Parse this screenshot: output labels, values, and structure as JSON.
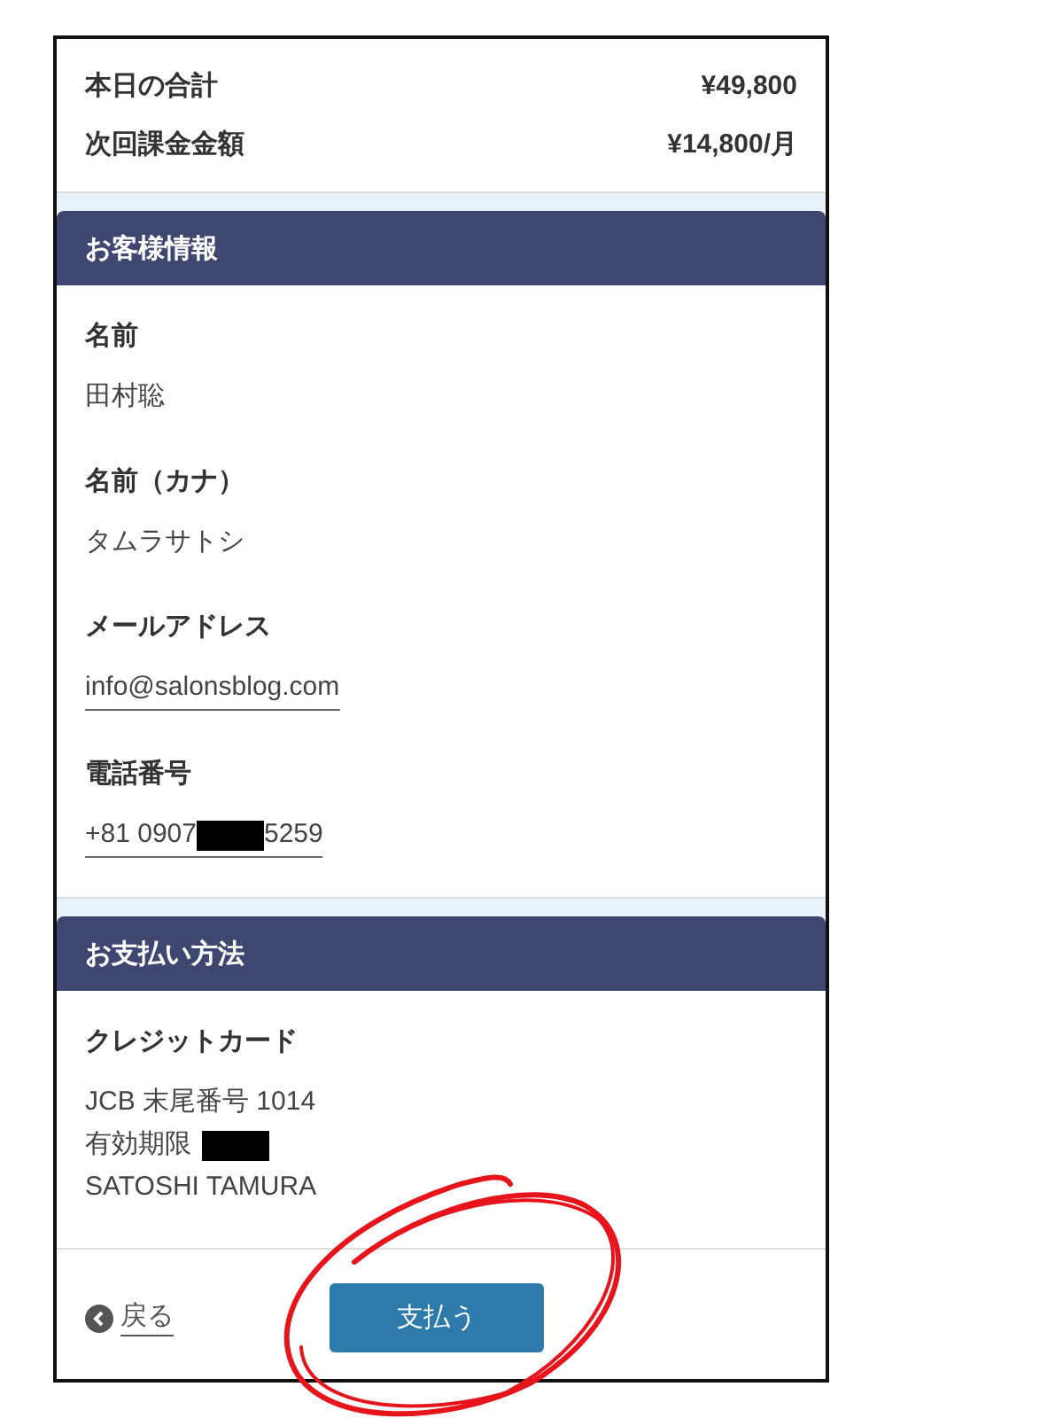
{
  "summary": [
    {
      "label": "本日の合計",
      "value": "¥49,800"
    },
    {
      "label": "次回課金金額",
      "value": "¥14,800/月"
    }
  ],
  "sections": [
    {
      "title": "お客様情報",
      "fields": [
        {
          "label": "名前",
          "kind": "plain",
          "lines": [
            [
              {
                "kind": "text",
                "text": "田村聡"
              }
            ]
          ]
        },
        {
          "label": "名前（カナ）",
          "kind": "plain",
          "lines": [
            [
              {
                "kind": "text",
                "text": "タムラサトシ"
              }
            ]
          ]
        },
        {
          "label": "メールアドレス",
          "kind": "link",
          "lines": [
            [
              {
                "kind": "text",
                "text": "info@salonsblog.com"
              }
            ]
          ]
        },
        {
          "label": "電話番号",
          "kind": "link",
          "lines": [
            [
              {
                "kind": "text",
                "text": "+81 0907"
              },
              {
                "kind": "redacted"
              },
              {
                "kind": "text",
                "text": "5259"
              }
            ]
          ]
        }
      ]
    },
    {
      "title": "お支払い方法",
      "fields": [
        {
          "label": "クレジットカード",
          "kind": "plain",
          "lines": [
            [
              {
                "kind": "text",
                "text": "JCB 末尾番号 1014"
              }
            ],
            [
              {
                "kind": "text",
                "text": "有効期限"
              },
              {
                "kind": "redacted"
              }
            ],
            [
              {
                "kind": "text",
                "text": "SATOSHI TAMURA"
              }
            ]
          ]
        }
      ]
    }
  ],
  "footer": {
    "back_link": "戻る",
    "pay_button": "支払う"
  }
}
